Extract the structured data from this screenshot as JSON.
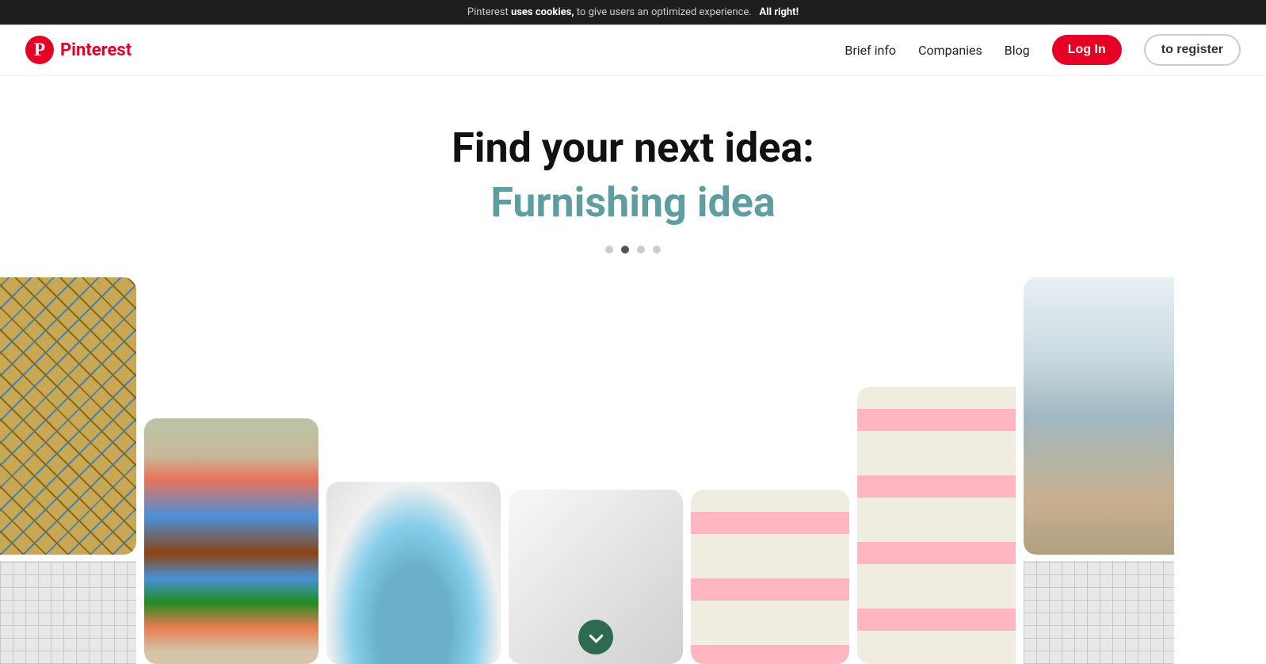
{
  "cookie_banner": {
    "text_before": "Pinterest ",
    "uses_cookies": "uses cookies,",
    "text_after": " to give users an optimized experience.",
    "accept_label": "All right!"
  },
  "header": {
    "logo_text": "Pinterest",
    "nav": {
      "brief_info": "Brief info",
      "companies": "Companies",
      "blog": "Blog"
    },
    "login_label": "Log In",
    "register_label": "to register"
  },
  "hero": {
    "title": "Find your next idea:",
    "subtitle": "Furnishing idea",
    "dots": [
      {
        "active": false
      },
      {
        "active": true
      },
      {
        "active": false
      },
      {
        "active": false
      }
    ]
  },
  "scroll_down_label": "scroll down"
}
